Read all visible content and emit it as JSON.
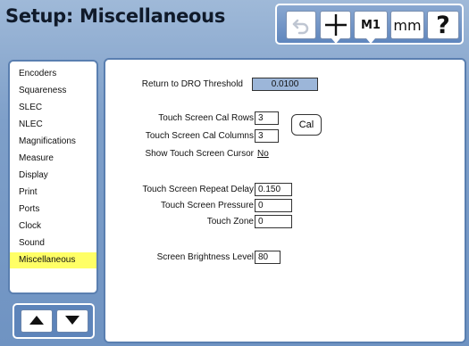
{
  "title": "Setup: Miscellaneous",
  "toolbar": {
    "undo_icon": "undo-arrow-icon",
    "crosshair_icon": "crosshair-plus-icon",
    "m1_label": "M1",
    "units_label": "mm",
    "help_label": "?"
  },
  "sidebar": {
    "items": [
      {
        "label": "Encoders"
      },
      {
        "label": "Squareness"
      },
      {
        "label": "SLEC"
      },
      {
        "label": "NLEC"
      },
      {
        "label": "Magnifications"
      },
      {
        "label": "Measure"
      },
      {
        "label": "Display"
      },
      {
        "label": "Print"
      },
      {
        "label": "Ports"
      },
      {
        "label": "Clock"
      },
      {
        "label": "Sound"
      },
      {
        "label": "Miscellaneous"
      }
    ],
    "active_index": 11,
    "active_color": "#ffff66"
  },
  "nav": {
    "up_icon": "arrow-up-icon",
    "down_icon": "arrow-down-icon"
  },
  "settings": {
    "threshold_label": "Return to DRO Threshold",
    "threshold_value": "0.0100",
    "cal_rows_label": "Touch Screen Cal Rows",
    "cal_rows_value": "3",
    "cal_cols_label": "Touch Screen Cal Columns",
    "cal_cols_value": "3",
    "cal_button": "Cal",
    "cursor_label": "Show Touch Screen Cursor",
    "cursor_value": "No",
    "repeat_label": "Touch Screen Repeat Delay",
    "repeat_value": "0.150",
    "pressure_label": "Touch Screen Pressure",
    "pressure_value": "0",
    "zone_label": "Touch Zone",
    "zone_value": "0",
    "brightness_label": "Screen Brightness Level",
    "brightness_value": "80"
  },
  "colors": {
    "background": "#7e9fc9",
    "highlight_field": "#9cb6d9",
    "selected_item": "#ffff66"
  }
}
